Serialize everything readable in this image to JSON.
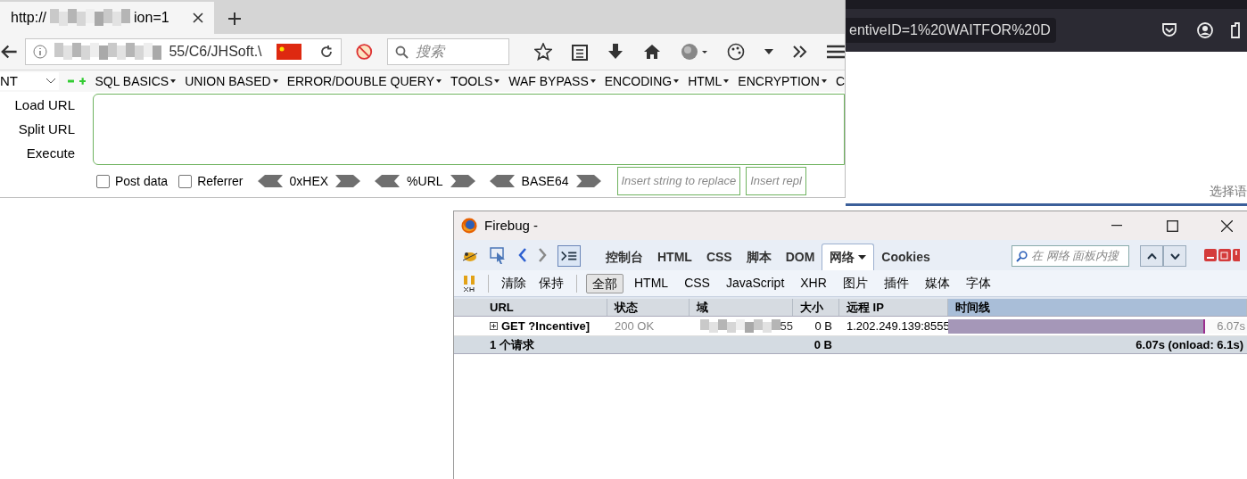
{
  "browser": {
    "tab": {
      "title_start": "http://",
      "title_end": "ion=1",
      "selected": true
    },
    "url_end": "55/C6/JHSoft.\\",
    "search_placeholder": "搜索"
  },
  "hackbar": {
    "select_value": "NT",
    "menus": [
      "SQL BASICS",
      "UNION BASED",
      "ERROR/DOUBLE QUERY",
      "TOOLS",
      "WAF BYPASS",
      "ENCODING",
      "HTML",
      "ENCRYPTION",
      "C"
    ],
    "actions": [
      "Load URL",
      "Split URL",
      "Execute"
    ],
    "options": [
      {
        "label": "Post data",
        "checked": false
      },
      {
        "label": "Referrer",
        "checked": false
      }
    ],
    "encoders": [
      "0xHEX",
      "%URL",
      "BASE64"
    ],
    "replace_fields": [
      {
        "placeholder": "Insert string to replace"
      },
      {
        "placeholder": "Insert repl"
      }
    ]
  },
  "background_window": {
    "url": "entiveID=1%20WAITFOR%20D",
    "language_hint": "选择语"
  },
  "firebug": {
    "title": "Firebug -",
    "panels": [
      {
        "label": "控制台",
        "selected": false
      },
      {
        "label": "HTML",
        "selected": false
      },
      {
        "label": "CSS",
        "selected": false
      },
      {
        "label": "脚本",
        "selected": false
      },
      {
        "label": "DOM",
        "selected": false
      },
      {
        "label": "网络",
        "selected": true
      },
      {
        "label": "Cookies",
        "selected": false
      }
    ],
    "search_placeholder": "在 网络 面板内搜",
    "actions": [
      "清除",
      "保持"
    ],
    "filters": [
      {
        "label": "全部",
        "selected": true
      },
      {
        "label": "HTML",
        "selected": false
      },
      {
        "label": "CSS",
        "selected": false
      },
      {
        "label": "JavaScript",
        "selected": false
      },
      {
        "label": "XHR",
        "selected": false
      },
      {
        "label": "图片",
        "selected": false
      },
      {
        "label": "插件",
        "selected": false
      },
      {
        "label": "媒体",
        "selected": false
      },
      {
        "label": "字体",
        "selected": false
      }
    ],
    "columns": [
      "URL",
      "状态",
      "域",
      "大小",
      "远程 IP",
      "时间线"
    ],
    "rows": [
      {
        "url": "GET ?Incentive]",
        "status": "200 OK",
        "domain_end": "55",
        "size": "0 B",
        "remote_ip": "1.202.249.139:8555",
        "level": 0.86,
        "time": "6.07s"
      }
    ],
    "summary": {
      "count": "1 个请求",
      "size": "0 B",
      "time": "6.07s (onload: 6.1s)"
    }
  }
}
